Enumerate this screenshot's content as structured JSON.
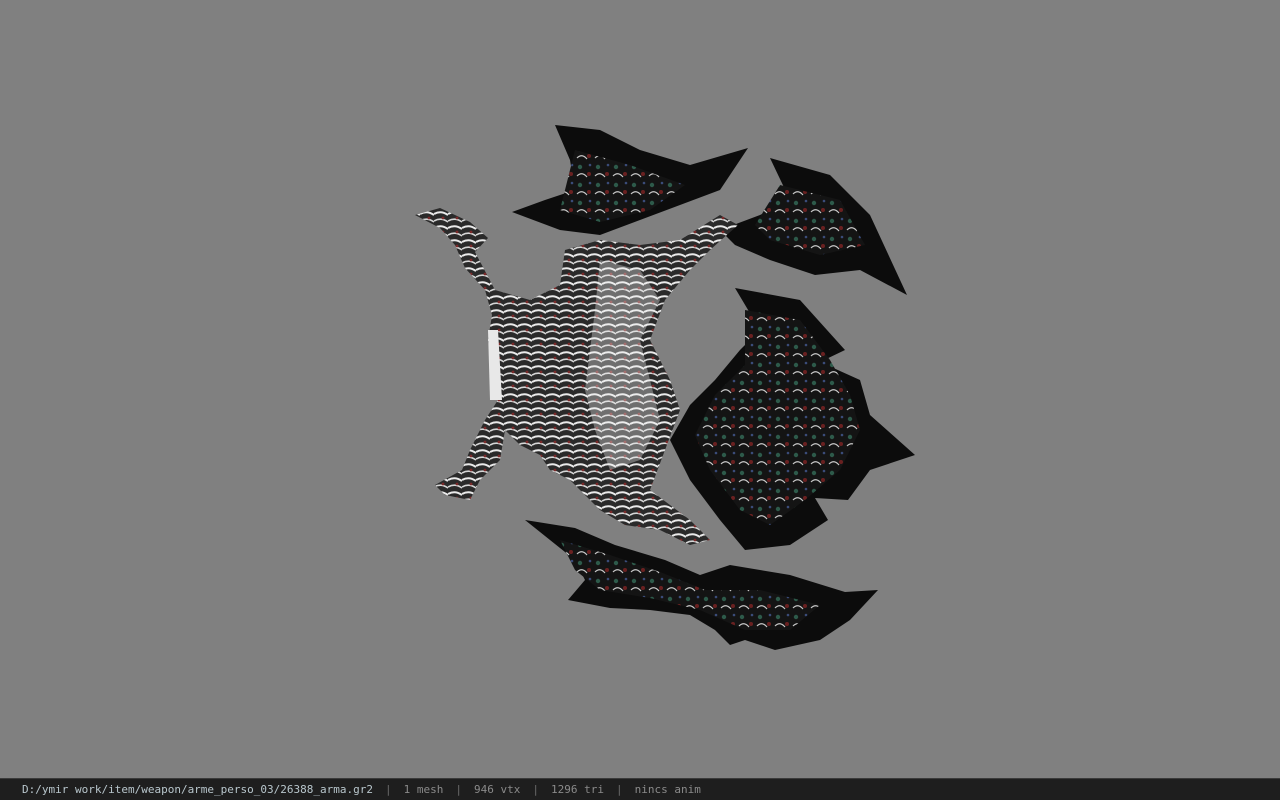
{
  "viewport": {
    "background": "#808080",
    "model_description_icon": "weapon-mesh-icon"
  },
  "status": {
    "file_path": "D:/ymir work/item/weapon/arme_perso_03/26388_arma.gr2",
    "mesh_count": "1 mesh",
    "vertex_count": "946 vtx",
    "triangle_count": "1296 tri",
    "animation": "nincs anim",
    "separator": "|"
  },
  "colors": {
    "statusbar_bg": "#1e1e1e",
    "path_text": "#b8c6cc",
    "stat_text": "#8a8a8a"
  }
}
